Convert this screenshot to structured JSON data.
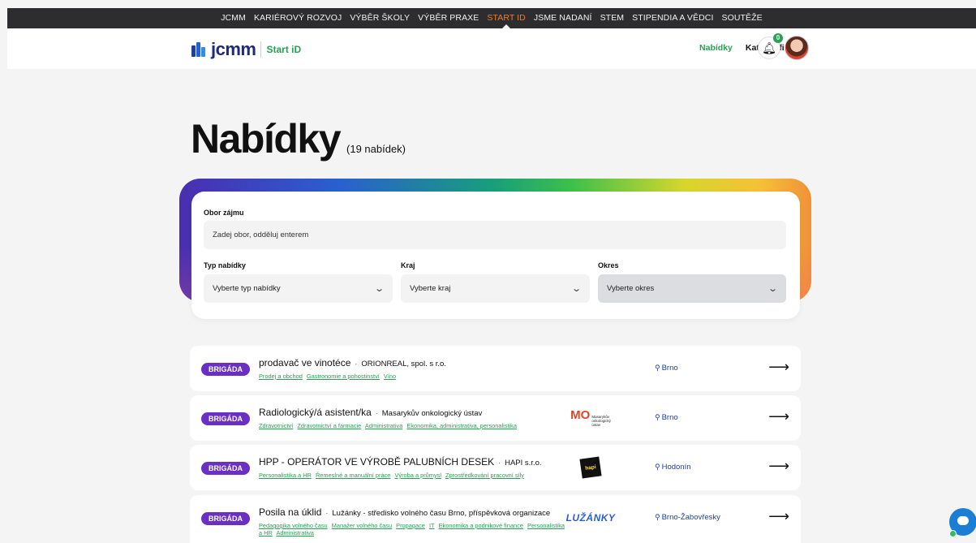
{
  "topnav": [
    "JCMM",
    "KARIÉROVÝ ROZVOJ",
    "VÝBĚR ŠKOLY",
    "VÝBĚR PRAXE",
    "START ID",
    "JSME NADANÍ",
    "STEM",
    "STIPENDIA A VĚDCI",
    "SOUTĚŽE"
  ],
  "header": {
    "logo_text": "jcmm",
    "brand_text": "Start iD",
    "nav_offers": "Nabídky",
    "nav_catalog": "Katalog firem",
    "notif_count": "0"
  },
  "page": {
    "title": "Nabídky",
    "count": "(19 nabídek)"
  },
  "filters": {
    "interest_label": "Obor zájmu",
    "interest_placeholder": "Zadej obor, odděluj enterem",
    "type_label": "Typ nabídky",
    "type_value": "Vyberte typ nabídky",
    "region_label": "Kraj",
    "region_value": "Vyberte kraj",
    "district_label": "Okres",
    "district_value": "Vyberte okres"
  },
  "offers": [
    {
      "badge": "BRIGÁDA",
      "title": "prodavač ve vinotéce",
      "company": "ORIONREAL, spol. s r.o.",
      "tags": [
        "Prodej a obchod",
        "Gastronomie a pohostinství",
        "Víno"
      ],
      "location": "Brno",
      "logo": ""
    },
    {
      "badge": "BRIGÁDA",
      "title": "Radiologický/á asistent/ka",
      "company": "Masarykův onkologický ústav",
      "tags": [
        "Zdravotnictví",
        "Zdravotnictví a farmacie",
        "Administrativa",
        "Ekonomika, administrativa, personalistika"
      ],
      "location": "Brno",
      "logo": "MO"
    },
    {
      "badge": "BRIGÁDA",
      "title": "HPP - OPERÁTOR VE VÝROBĚ PALUBNÍCH DESEK",
      "company": "HAPI s.r.o.",
      "tags": [
        "Personalistika a HR",
        "Řemeslné a manuální práce",
        "Výroba a průmysl",
        "Zprostředkování pracovní síly"
      ],
      "location": "Hodonín",
      "logo": "hapi"
    },
    {
      "badge": "BRIGÁDA",
      "title": "Posila na úklid",
      "company": "Lužánky - středisko volného času Brno, příspěvková organizace",
      "tags": [
        "Pedagogika volného času",
        "Manažer volného času",
        "Propagace",
        "IT",
        "Ekonomika a podnikové finance",
        "Personalistika a HR",
        "Administrativa"
      ],
      "location": "Brno-Žabovřesky",
      "logo": "LUŽÁNKY"
    }
  ],
  "colors": {
    "accent_green": "#27a153",
    "badge_purple": "#6b2fc4",
    "topbar": "#2d2d2f",
    "active_nav": "#f07a2b"
  },
  "icons": {
    "bell": "bell-icon",
    "pin": "location-pin-icon",
    "arrow": "arrow-right-icon",
    "chevron": "chevron-down-icon",
    "chat": "chat-icon"
  }
}
